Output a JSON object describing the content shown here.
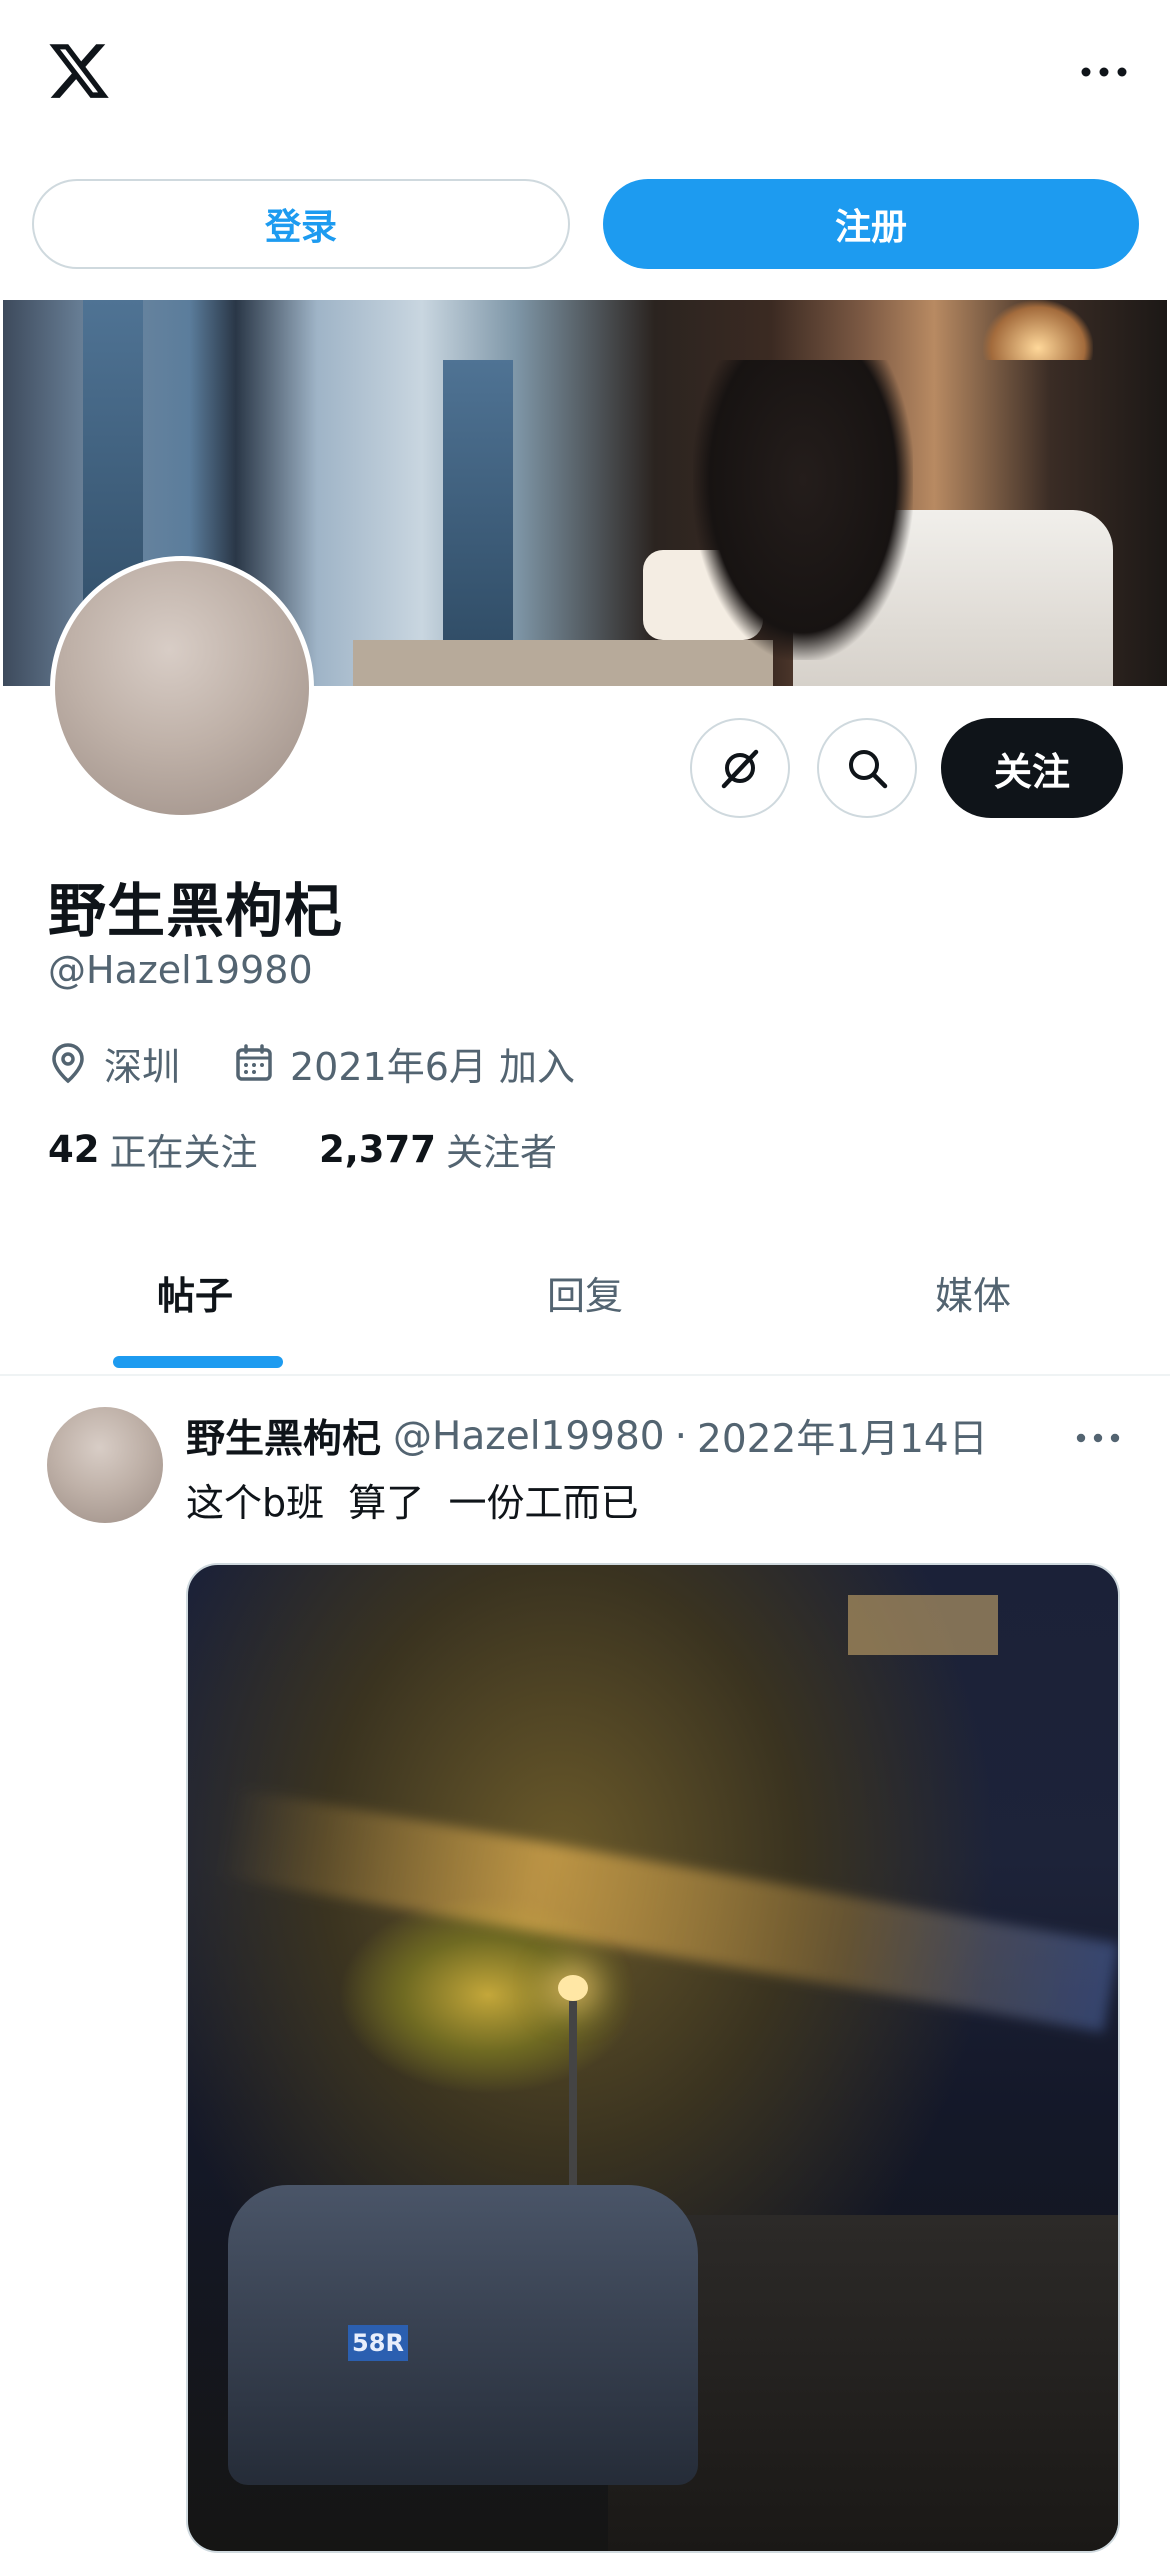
{
  "header": {
    "logo_icon": "x-logo-icon",
    "more_icon": "more-horizontal-icon"
  },
  "auth": {
    "login_label": "登录",
    "signup_label": "注册"
  },
  "profile": {
    "name": "野生黑枸杞",
    "handle": "@Hazel19980",
    "location": "深圳",
    "joined": "2021年6月 加入",
    "following_count": "42",
    "following_label": "正在关注",
    "followers_count": "2,377",
    "followers_label": "关注者",
    "follow_label": "关注"
  },
  "tabs": [
    {
      "label": "帖子",
      "active": true
    },
    {
      "label": "回复",
      "active": false
    },
    {
      "label": "媒体",
      "active": false
    }
  ],
  "post": {
    "author_name": "野生黑枸杞",
    "author_handle": "@Hazel19980",
    "separator": "·",
    "date": "2022年1月14日",
    "text": "这个b班  算了  一份工而已",
    "image_plate_text": "58R"
  },
  "colors": {
    "accent": "#1d9bf0",
    "text_primary": "#0f1419",
    "text_secondary": "#536471",
    "border": "#cfd9de"
  }
}
